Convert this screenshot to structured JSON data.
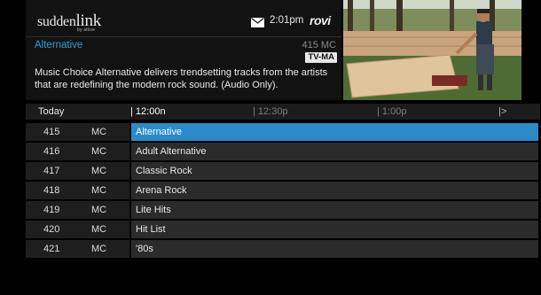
{
  "header": {
    "brand_main": "sudden",
    "brand_link": "link",
    "brand_sub": "by altice",
    "time": "2:01pm",
    "rovi": "rovi",
    "program_title": "Alternative",
    "channel_info": "415 MC",
    "rating": "TV-MA",
    "description": "Music Choice Alternative delivers trendsetting tracks from the artists that are redefining the modern rock sound. (Audio Only)."
  },
  "timebar": {
    "today": "Today",
    "slot1": "| 12:00n",
    "slot2": "| 12:30p",
    "slot3": "| 1:00p",
    "next": "|>"
  },
  "rows": [
    {
      "num": "415",
      "net": "MC",
      "program": "Alternative",
      "selected": true
    },
    {
      "num": "416",
      "net": "MC",
      "program": "Adult Alternative"
    },
    {
      "num": "417",
      "net": "MC",
      "program": "Classic Rock"
    },
    {
      "num": "418",
      "net": "MC",
      "program": "Arena Rock"
    },
    {
      "num": "419",
      "net": "MC",
      "program": "Lite Hits"
    },
    {
      "num": "420",
      "net": "MC",
      "program": "Hit List"
    },
    {
      "num": "421",
      "net": "MC",
      "program": "'80s"
    }
  ],
  "icons": {
    "mail": "mail-icon",
    "next": "chevron-right-icon"
  },
  "colors": {
    "accent": "#2b8bc9",
    "title": "#2f9fdd",
    "row_bg": "#2b2b2b",
    "panel_bg": "#121212"
  }
}
